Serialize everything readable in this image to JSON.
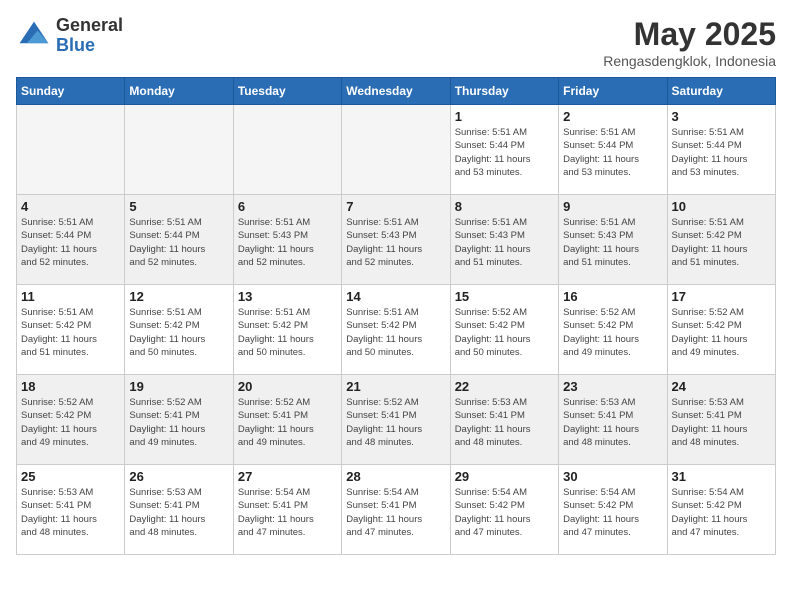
{
  "logo": {
    "general": "General",
    "blue": "Blue"
  },
  "title": "May 2025",
  "location": "Rengasdengklok, Indonesia",
  "weekdays": [
    "Sunday",
    "Monday",
    "Tuesday",
    "Wednesday",
    "Thursday",
    "Friday",
    "Saturday"
  ],
  "weeks": [
    [
      {
        "day": "",
        "info": ""
      },
      {
        "day": "",
        "info": ""
      },
      {
        "day": "",
        "info": ""
      },
      {
        "day": "",
        "info": ""
      },
      {
        "day": "1",
        "info": "Sunrise: 5:51 AM\nSunset: 5:44 PM\nDaylight: 11 hours\nand 53 minutes."
      },
      {
        "day": "2",
        "info": "Sunrise: 5:51 AM\nSunset: 5:44 PM\nDaylight: 11 hours\nand 53 minutes."
      },
      {
        "day": "3",
        "info": "Sunrise: 5:51 AM\nSunset: 5:44 PM\nDaylight: 11 hours\nand 53 minutes."
      }
    ],
    [
      {
        "day": "4",
        "info": "Sunrise: 5:51 AM\nSunset: 5:44 PM\nDaylight: 11 hours\nand 52 minutes."
      },
      {
        "day": "5",
        "info": "Sunrise: 5:51 AM\nSunset: 5:44 PM\nDaylight: 11 hours\nand 52 minutes."
      },
      {
        "day": "6",
        "info": "Sunrise: 5:51 AM\nSunset: 5:43 PM\nDaylight: 11 hours\nand 52 minutes."
      },
      {
        "day": "7",
        "info": "Sunrise: 5:51 AM\nSunset: 5:43 PM\nDaylight: 11 hours\nand 52 minutes."
      },
      {
        "day": "8",
        "info": "Sunrise: 5:51 AM\nSunset: 5:43 PM\nDaylight: 11 hours\nand 51 minutes."
      },
      {
        "day": "9",
        "info": "Sunrise: 5:51 AM\nSunset: 5:43 PM\nDaylight: 11 hours\nand 51 minutes."
      },
      {
        "day": "10",
        "info": "Sunrise: 5:51 AM\nSunset: 5:42 PM\nDaylight: 11 hours\nand 51 minutes."
      }
    ],
    [
      {
        "day": "11",
        "info": "Sunrise: 5:51 AM\nSunset: 5:42 PM\nDaylight: 11 hours\nand 51 minutes."
      },
      {
        "day": "12",
        "info": "Sunrise: 5:51 AM\nSunset: 5:42 PM\nDaylight: 11 hours\nand 50 minutes."
      },
      {
        "day": "13",
        "info": "Sunrise: 5:51 AM\nSunset: 5:42 PM\nDaylight: 11 hours\nand 50 minutes."
      },
      {
        "day": "14",
        "info": "Sunrise: 5:51 AM\nSunset: 5:42 PM\nDaylight: 11 hours\nand 50 minutes."
      },
      {
        "day": "15",
        "info": "Sunrise: 5:52 AM\nSunset: 5:42 PM\nDaylight: 11 hours\nand 50 minutes."
      },
      {
        "day": "16",
        "info": "Sunrise: 5:52 AM\nSunset: 5:42 PM\nDaylight: 11 hours\nand 49 minutes."
      },
      {
        "day": "17",
        "info": "Sunrise: 5:52 AM\nSunset: 5:42 PM\nDaylight: 11 hours\nand 49 minutes."
      }
    ],
    [
      {
        "day": "18",
        "info": "Sunrise: 5:52 AM\nSunset: 5:42 PM\nDaylight: 11 hours\nand 49 minutes."
      },
      {
        "day": "19",
        "info": "Sunrise: 5:52 AM\nSunset: 5:41 PM\nDaylight: 11 hours\nand 49 minutes."
      },
      {
        "day": "20",
        "info": "Sunrise: 5:52 AM\nSunset: 5:41 PM\nDaylight: 11 hours\nand 49 minutes."
      },
      {
        "day": "21",
        "info": "Sunrise: 5:52 AM\nSunset: 5:41 PM\nDaylight: 11 hours\nand 48 minutes."
      },
      {
        "day": "22",
        "info": "Sunrise: 5:53 AM\nSunset: 5:41 PM\nDaylight: 11 hours\nand 48 minutes."
      },
      {
        "day": "23",
        "info": "Sunrise: 5:53 AM\nSunset: 5:41 PM\nDaylight: 11 hours\nand 48 minutes."
      },
      {
        "day": "24",
        "info": "Sunrise: 5:53 AM\nSunset: 5:41 PM\nDaylight: 11 hours\nand 48 minutes."
      }
    ],
    [
      {
        "day": "25",
        "info": "Sunrise: 5:53 AM\nSunset: 5:41 PM\nDaylight: 11 hours\nand 48 minutes."
      },
      {
        "day": "26",
        "info": "Sunrise: 5:53 AM\nSunset: 5:41 PM\nDaylight: 11 hours\nand 48 minutes."
      },
      {
        "day": "27",
        "info": "Sunrise: 5:54 AM\nSunset: 5:41 PM\nDaylight: 11 hours\nand 47 minutes."
      },
      {
        "day": "28",
        "info": "Sunrise: 5:54 AM\nSunset: 5:41 PM\nDaylight: 11 hours\nand 47 minutes."
      },
      {
        "day": "29",
        "info": "Sunrise: 5:54 AM\nSunset: 5:42 PM\nDaylight: 11 hours\nand 47 minutes."
      },
      {
        "day": "30",
        "info": "Sunrise: 5:54 AM\nSunset: 5:42 PM\nDaylight: 11 hours\nand 47 minutes."
      },
      {
        "day": "31",
        "info": "Sunrise: 5:54 AM\nSunset: 5:42 PM\nDaylight: 11 hours\nand 47 minutes."
      }
    ]
  ]
}
